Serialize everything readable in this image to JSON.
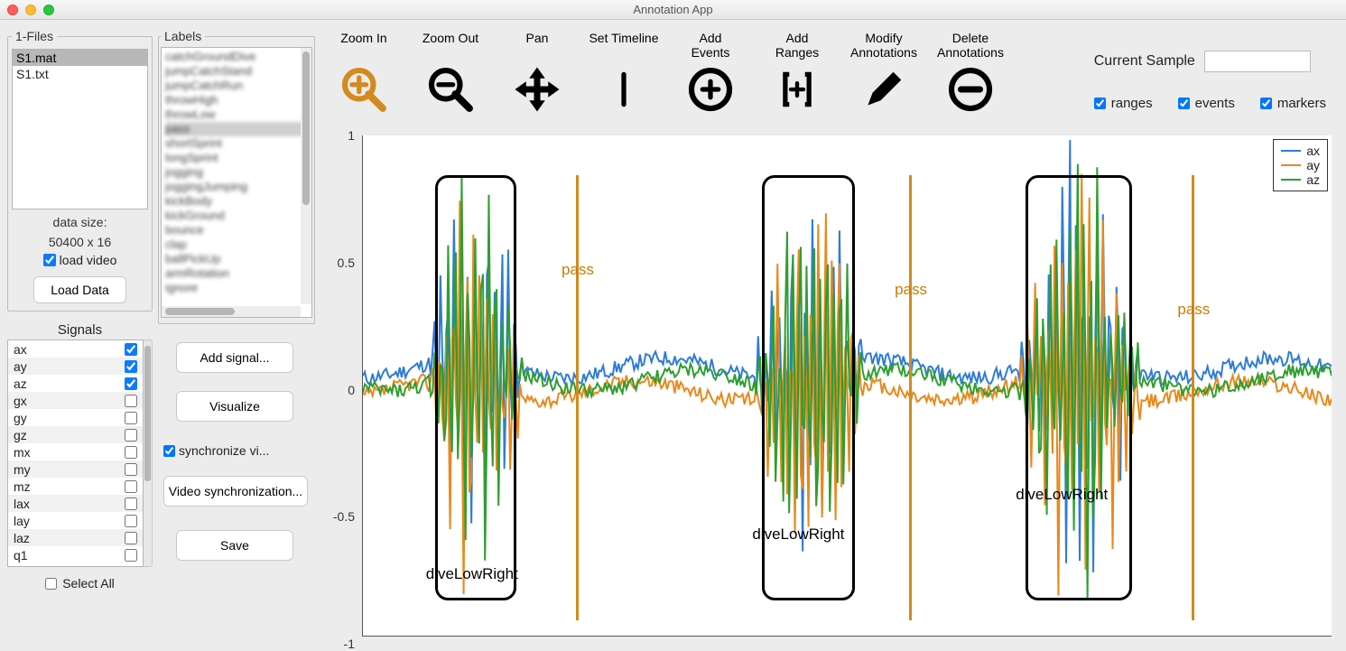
{
  "window": {
    "title": "Annotation App"
  },
  "files": {
    "legend": "1-Files",
    "items": [
      "S1.mat",
      "S1.txt"
    ],
    "selected_index": 0,
    "data_size_label": "data size:",
    "data_size_value": "50400 x 16",
    "load_video_label": "load video",
    "load_video_checked": true,
    "load_button": "Load Data"
  },
  "labels": {
    "legend": "Labels",
    "items": [
      "catchGroundDive",
      "jumpCatchStand",
      "jumpCatchRun",
      "throwHigh",
      "throwLow",
      "pass",
      "shortSprint",
      "longSprint",
      "jogging",
      "joggingJumping",
      "kickBody",
      "kickGround",
      "bounce",
      "clap",
      "ballPickUp",
      "armRotation",
      "ignore"
    ],
    "selected_index": 5
  },
  "signals": {
    "title": "Signals",
    "items": [
      {
        "name": "ax",
        "checked": true
      },
      {
        "name": "ay",
        "checked": true
      },
      {
        "name": "az",
        "checked": true
      },
      {
        "name": "gx",
        "checked": false
      },
      {
        "name": "gy",
        "checked": false
      },
      {
        "name": "gz",
        "checked": false
      },
      {
        "name": "mx",
        "checked": false
      },
      {
        "name": "my",
        "checked": false
      },
      {
        "name": "mz",
        "checked": false
      },
      {
        "name": "lax",
        "checked": false
      },
      {
        "name": "lay",
        "checked": false
      },
      {
        "name": "laz",
        "checked": false
      },
      {
        "name": "q1",
        "checked": false
      }
    ],
    "select_all_label": "Select All",
    "select_all_checked": false
  },
  "mid_buttons": {
    "add_signal": "Add signal...",
    "visualize": "Visualize",
    "sync_label": "synchronize vi...",
    "sync_checked": true,
    "video_sync": "Video synchronization...",
    "save": "Save"
  },
  "toolbar": {
    "zoom_in": "Zoom In",
    "zoom_out": "Zoom Out",
    "pan": "Pan",
    "set_timeline": "Set Timeline",
    "add_events": "Add\nEvents",
    "add_ranges": "Add\nRanges",
    "modify": "Modify\nAnnotations",
    "delete": "Delete\nAnnotations",
    "current_sample": "Current Sample",
    "current_sample_value": "",
    "opt_ranges": "ranges",
    "opt_events": "events",
    "opt_markers": "markers"
  },
  "chart_data": {
    "type": "line",
    "ylim": [
      -1,
      1
    ],
    "yticks": [
      -1,
      -0.5,
      0,
      0.5,
      1
    ],
    "series": [
      {
        "name": "ax",
        "color": "#2e7cd6"
      },
      {
        "name": "ay",
        "color": "#e8891c"
      },
      {
        "name": "az",
        "color": "#2f9e2f"
      }
    ],
    "ranges": [
      {
        "label": "diveLowRight",
        "x_pct": 7.5,
        "w_pct": 8.3
      },
      {
        "label": "diveLowRight",
        "x_pct": 41.2,
        "w_pct": 9.6
      },
      {
        "label": "diveLowRight",
        "x_pct": 68.4,
        "w_pct": 11.0
      }
    ],
    "events": [
      {
        "label": "pass",
        "x_pct": 22.0
      },
      {
        "label": "pass",
        "x_pct": 56.4
      },
      {
        "label": "pass",
        "x_pct": 85.6
      }
    ]
  }
}
